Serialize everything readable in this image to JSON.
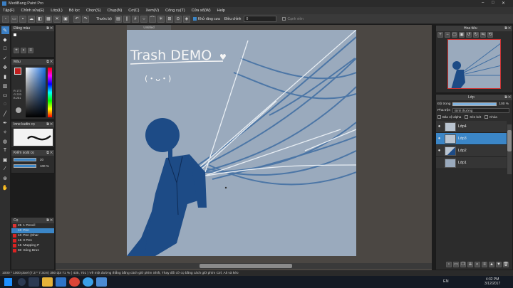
{
  "app": {
    "title": "MediBang Paint Pro"
  },
  "menu": [
    "Tập(F)",
    "Chỉnh sửa(E)",
    "Lớp(L)",
    "Bộ lọc",
    "Chọn(S)",
    "Chụp(N)",
    "Cơ(C)",
    "Xem(V)",
    "Cửa sổ(W)",
    "Cửa sổ(W)",
    "Help"
  ],
  "menu_fixed": [
    "Tập(F)",
    "Chỉnh sửa(E)",
    "Lớp(L)",
    "Bộ lọc",
    "Chọn(S)",
    "Chụp(N)",
    "Cơ(C)",
    "Xem(V)",
    "Công cụ(T)",
    "Cửa sổ(W)",
    "Help"
  ],
  "toolbar": {
    "thuoc_label": "Thước bộ",
    "khu_rang_cua": "Khử răng cưa",
    "dieu_chinh_label": "Điều chỉnh",
    "dieu_chinh_value": "0",
    "canh_vien": "Cạnh viền"
  },
  "left_panels": {
    "brush_size_title": "Đăng màu",
    "color_title": "Màu",
    "rgb_r": "R 173",
    "rgb_g": "G 223",
    "rgb_b": "B 251",
    "brush_control_title": "Kiểm soát cọ",
    "size_value": "20",
    "opacity_value": "100 %",
    "curve_title": "Inne kudin cọ",
    "brush_list_title": "Cọ",
    "brushes": [
      {
        "size": "25",
        "name": "1 Pencil",
        "color": "#d33"
      },
      {
        "size": "10",
        "name": "Pen",
        "color": "#3b7fc4"
      },
      {
        "size": "10",
        "name": "Pen (Shar",
        "color": "#d33"
      },
      {
        "size": "15",
        "name": "0 Pen",
        "color": "#d33"
      },
      {
        "size": "15",
        "name": "Mapping P",
        "color": "#d33"
      },
      {
        "size": "60",
        "name": "Sóng Brus",
        "color": "#d33"
      }
    ]
  },
  "canvas": {
    "tab_label": "Untitled",
    "caption": "Trash DEMO",
    "heart": "♥",
    "face": "(・ᴗ・)"
  },
  "navigator": {
    "title": "Hoa tiêu"
  },
  "layers_panel": {
    "title": "Lớp",
    "opacity_label": "Độ trong",
    "opacity_value": "100 %",
    "blend_label": "Pha trộn",
    "blend_value": "Bình thường",
    "opt_alpha": "Bảo vệ alpha",
    "opt_clip": "Xén bớt",
    "opt_lock": "Khóa",
    "layers": [
      {
        "name": "Lớp4"
      },
      {
        "name": "Lớp3"
      },
      {
        "name": "Lớp2"
      },
      {
        "name": "Lớp1"
      }
    ]
  },
  "status": {
    "text": "1000 * 1000 pixel  (7.3 * 7.3cm)  350 dpi  71 %  ( 435, 701 )  Vẽ một đường thẳng bằng cách giữ phím Shift, Thay đổi cỡ cọ bằng cách giữ phím Ctrl, Alt và kéo"
  },
  "taskbar": {
    "lang": "EN",
    "time": "4:32 PM",
    "date": "3/12/2017"
  },
  "colors": {
    "accent": "#3b86c7",
    "canvas_bg": "#9aaabd",
    "ink": "#1d4b86"
  }
}
